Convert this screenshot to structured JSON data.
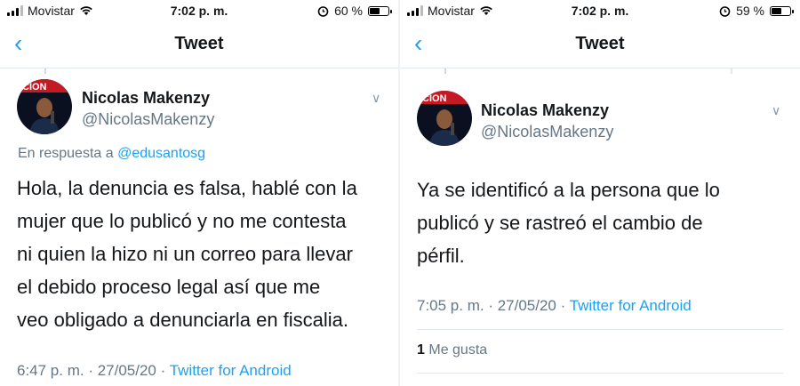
{
  "left": {
    "status": {
      "carrier": "Movistar",
      "time": "7:02 p. m.",
      "battery_text": "60 %",
      "battery_level": 0.6
    },
    "nav": {
      "title": "Tweet",
      "back_icon": "chevron-left-icon"
    },
    "tweet": {
      "author_name": "Nicolas Makenzy",
      "author_handle": "@NicolasMakenzy",
      "reply_prefix": "En respuesta a",
      "reply_mention": "@edusantosg",
      "text_lines": [
        "Hola, la denuncia es falsa, hablé con la",
        "mujer que lo publicó y no me contesta",
        "ni quien la hizo ni un correo para llevar",
        "el debido proceso legal así que me",
        "veo obligado a denunciarla en fiscalia."
      ],
      "timestamp": "6:47 p. m. · 27/05/20 ·",
      "source": "Twitter for Android"
    }
  },
  "right": {
    "status": {
      "carrier": "Movistar",
      "time": "7:02 p. m.",
      "battery_text": "59 %",
      "battery_level": 0.59
    },
    "nav": {
      "title": "Tweet",
      "back_icon": "chevron-left-icon"
    },
    "tweet": {
      "author_name": "Nicolas Makenzy",
      "author_handle": "@NicolasMakenzy",
      "text_lines": [
        "Ya se identificó a la persona que lo",
        "publicó y se rastreó el cambio de",
        "pérfil."
      ],
      "timestamp": "7:05 p. m. · 27/05/20 ·",
      "source": "Twitter for Android",
      "likes_count": "1",
      "likes_label": "Me gusta"
    }
  },
  "colors": {
    "accent": "#1da1f2",
    "muted": "#657786",
    "text": "#14171a"
  }
}
